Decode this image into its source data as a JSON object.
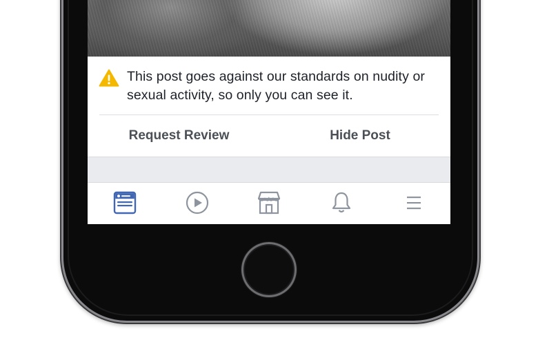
{
  "notice": {
    "message": "This post goes against our standards on nudity or sexual activity, so only you can see it.",
    "icon": "warning-icon",
    "icon_color": "#f5b800"
  },
  "actions": {
    "request_review_label": "Request Review",
    "hide_post_label": "Hide Post"
  },
  "tabbar": {
    "active_color": "#4267b2",
    "inactive_color": "#8d949e",
    "tabs": [
      {
        "name": "news-feed",
        "icon": "news-feed-icon",
        "active": true
      },
      {
        "name": "watch",
        "icon": "play-icon",
        "active": false
      },
      {
        "name": "marketplace",
        "icon": "storefront-icon",
        "active": false
      },
      {
        "name": "notifications",
        "icon": "bell-icon",
        "active": false
      },
      {
        "name": "menu",
        "icon": "hamburger-menu-icon",
        "active": false
      }
    ]
  },
  "device": {
    "home_button_icon": "home-button"
  }
}
